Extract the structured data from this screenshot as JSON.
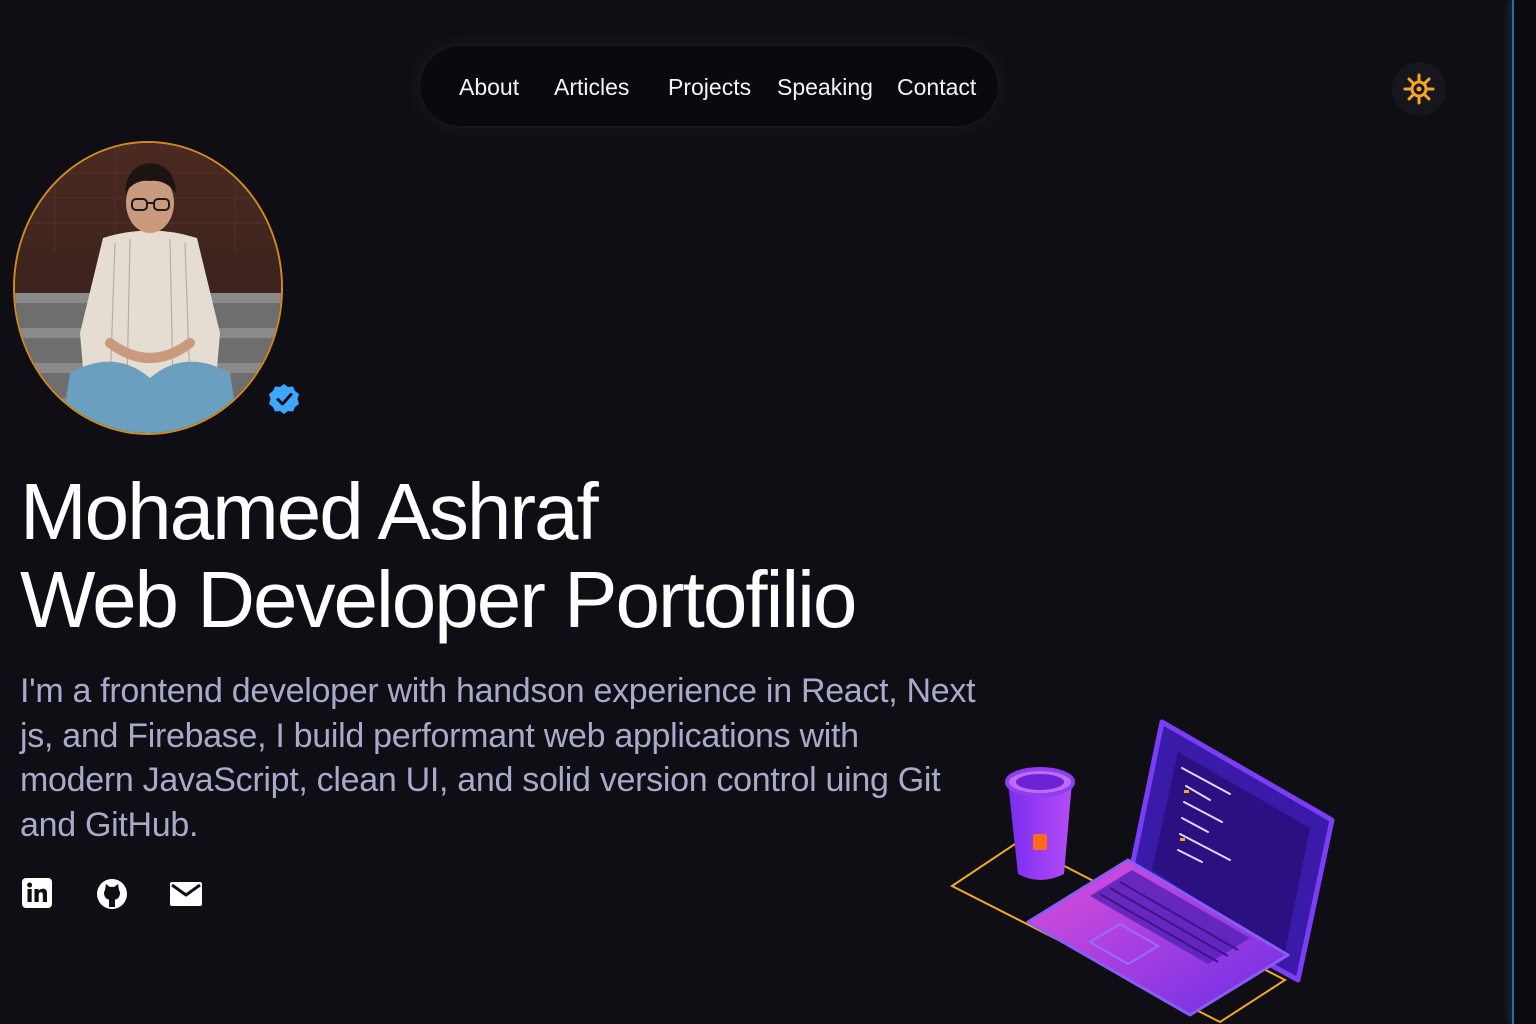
{
  "nav": {
    "items": [
      {
        "label": "About"
      },
      {
        "label": "Articles"
      },
      {
        "label": "Projects"
      },
      {
        "label": "Speaking"
      },
      {
        "label": "Contact"
      }
    ]
  },
  "theme_toggle": {
    "icon": "sun-icon",
    "color": "#f5a623"
  },
  "profile": {
    "avatar_ring_color": "#d18a1e",
    "verified_color": "#3ea6ff"
  },
  "hero": {
    "title_line1": "Mohamed Ashraf",
    "title_line2": "Web Developer Portofilio",
    "bio": "I'm a frontend developer with handson experience in React, Next js, and Firebase, I build performant web applications with modern JavaScript, clean UI, and solid version control uing Git and GitHub."
  },
  "socials": [
    {
      "icon": "linkedin-icon"
    },
    {
      "icon": "github-icon"
    },
    {
      "icon": "mail-icon"
    }
  ],
  "colors": {
    "background": "#0f0e14",
    "bio_text": "#a7aacb",
    "accent_purple": "#7b2cf0",
    "accent_orange": "#f5a623"
  }
}
